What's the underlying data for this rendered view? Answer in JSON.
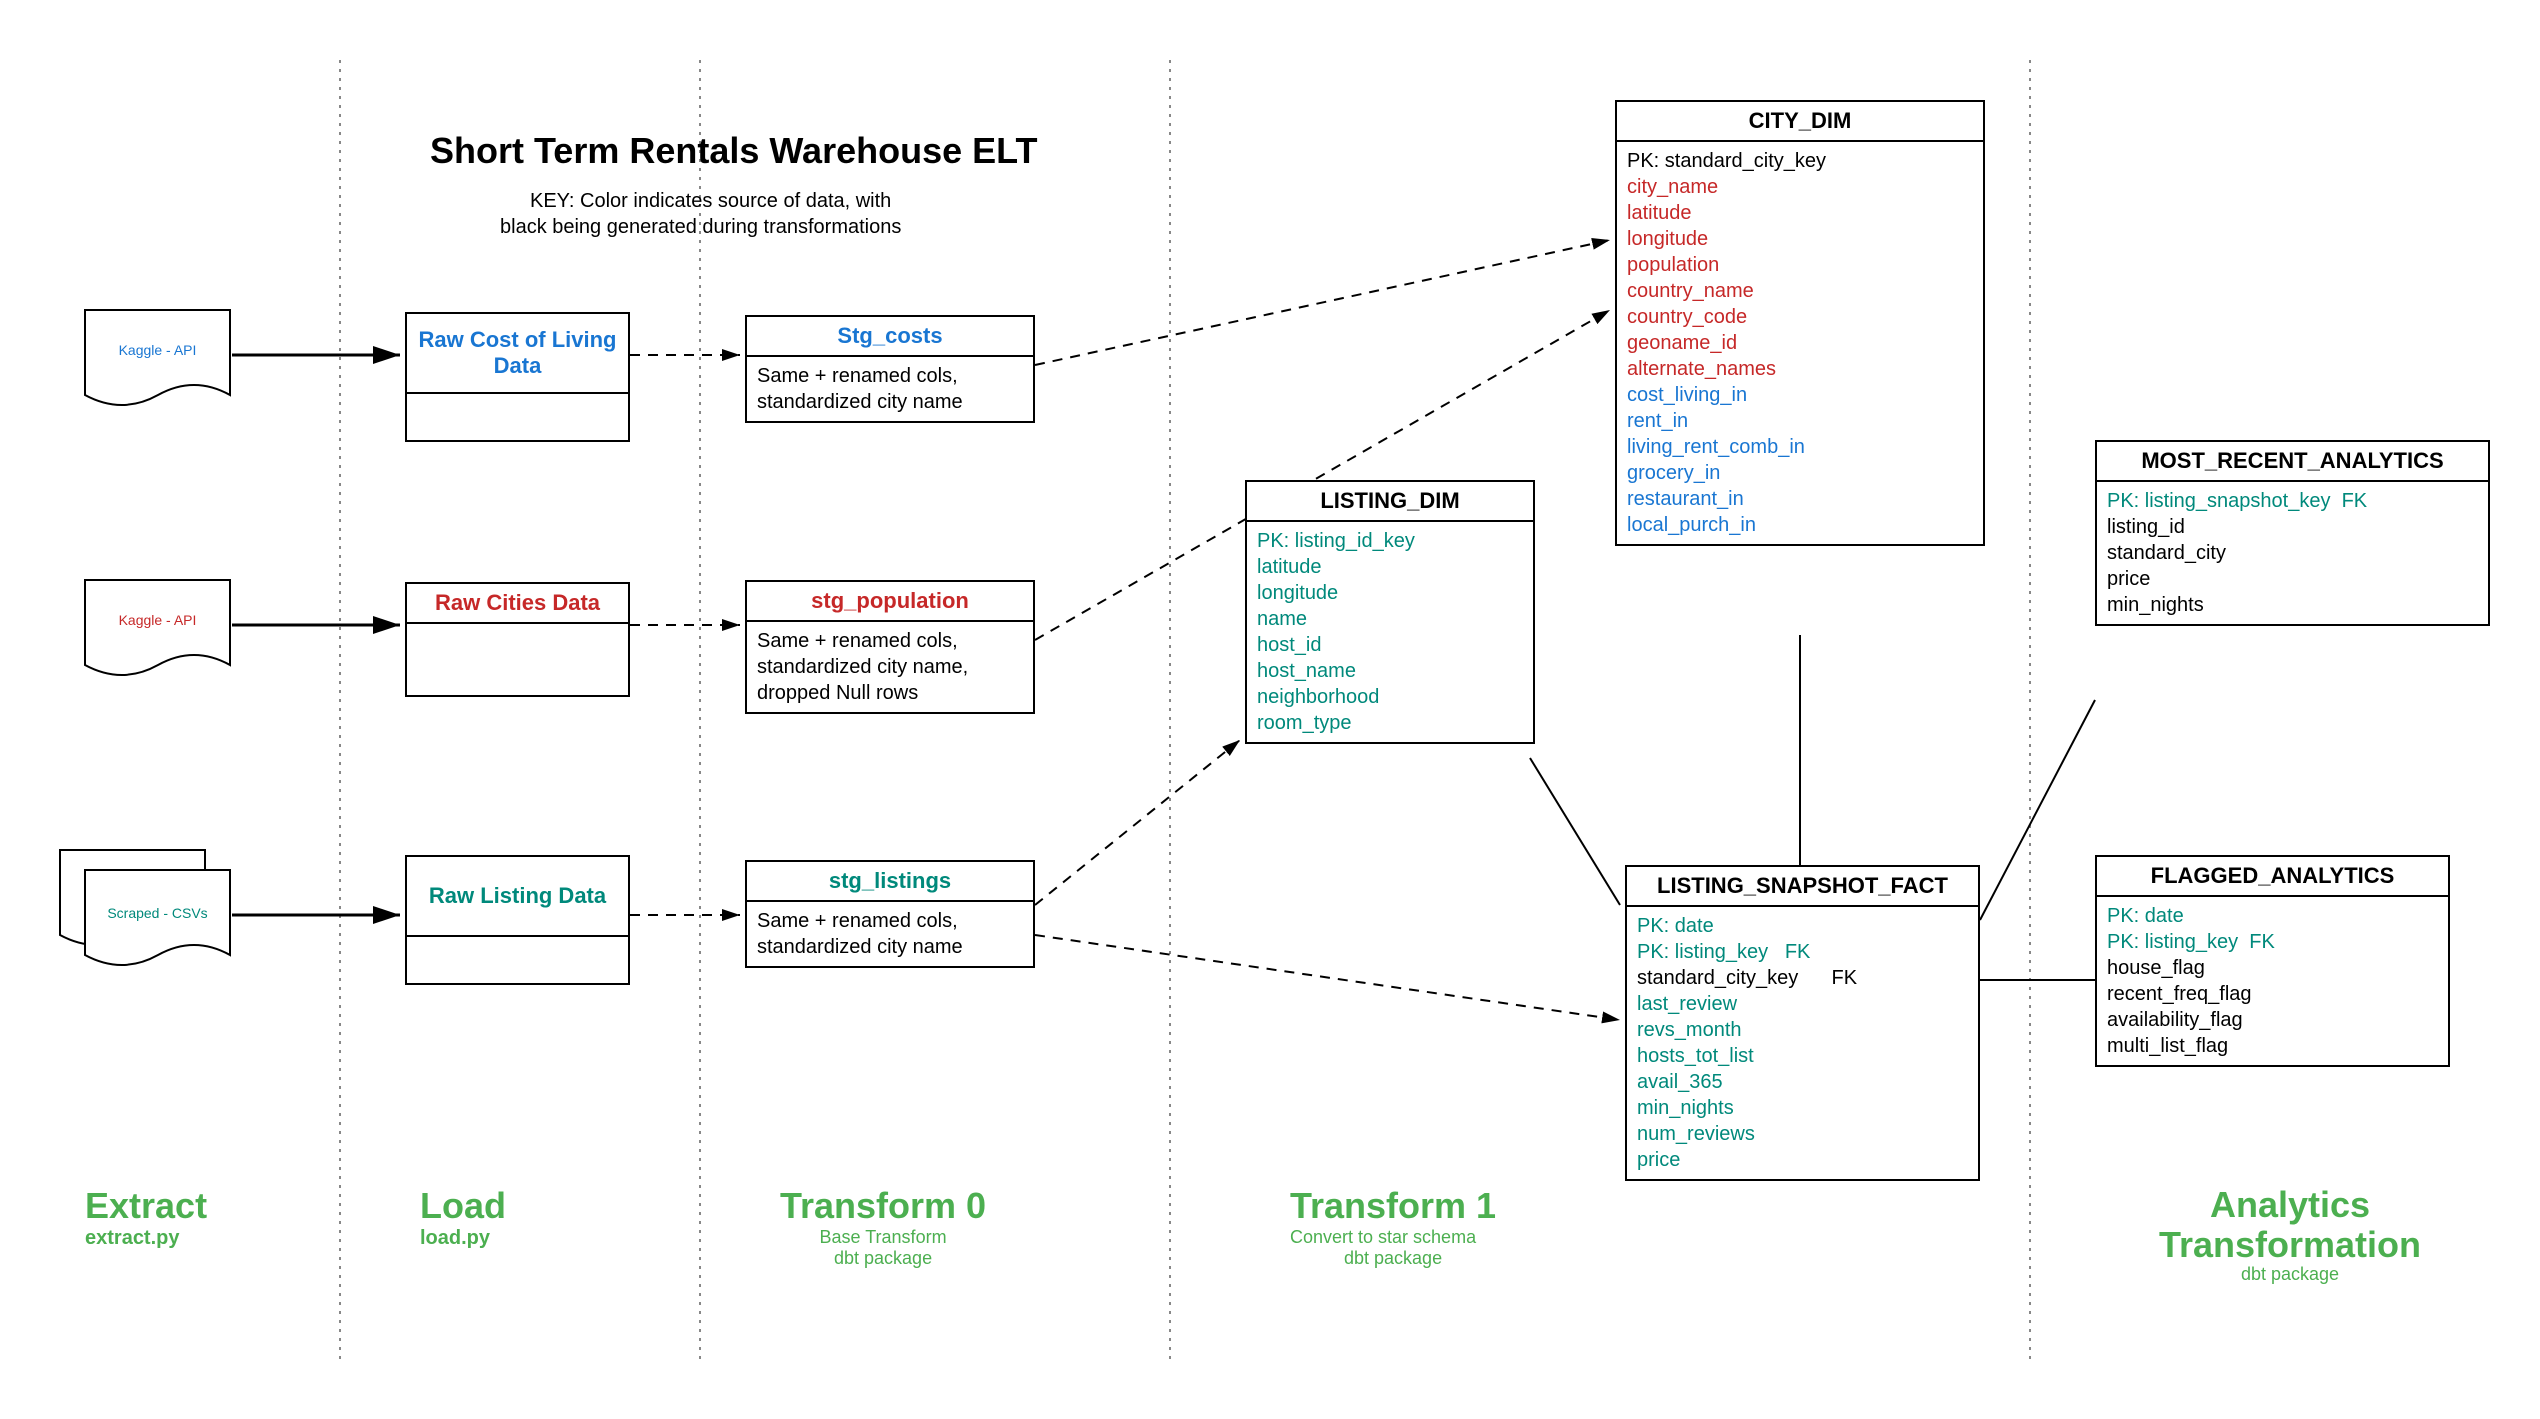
{
  "header": {
    "title": "Short Term Rentals Warehouse ELT",
    "key1": "KEY: Color indicates source of data, with",
    "key2": "black being generated during transformations"
  },
  "lanes": {
    "extract": {
      "title": "Extract",
      "sub": "extract.py"
    },
    "load": {
      "title": "Load",
      "sub": "load.py"
    },
    "t0": {
      "title": "Transform 0",
      "sub1": "Base Transform",
      "sub2": "dbt package"
    },
    "t1": {
      "title": "Transform 1",
      "sub1": "Convert to star schema",
      "sub2": "dbt package"
    },
    "analytics": {
      "title": "Analytics Transformation",
      "sub": "dbt package"
    }
  },
  "sources": {
    "kaggle1": "Kaggle - API",
    "kaggle2": "Kaggle - API",
    "scraped": "Scraped - CSVs"
  },
  "raw": {
    "cost": "Raw Cost of Living Data",
    "cities": "Raw Cities Data",
    "listing": "Raw Listing Data"
  },
  "stg": {
    "costs": {
      "name": "Stg_costs",
      "desc": "Same + renamed cols, standardized city name"
    },
    "population": {
      "name": "stg_population",
      "desc": "Same + renamed cols, standardized city name, dropped Null rows"
    },
    "listings": {
      "name": "stg_listings",
      "desc": "Same + renamed cols, standardized city name"
    }
  },
  "tables": {
    "listing_dim": {
      "name": "LISTING_DIM",
      "fields": [
        "PK: listing_id_key",
        "latitude",
        "longitude",
        "name",
        "host_id",
        "host_name",
        "neighborhood",
        "room_type"
      ]
    },
    "city_dim": {
      "name": "CITY_DIM",
      "pk": "PK: standard_city_key",
      "red": [
        "city_name",
        "latitude",
        "longitude",
        "population",
        "country_name",
        "country_code",
        "geoname_id",
        "alternate_names"
      ],
      "blue": [
        "cost_living_in",
        "rent_in",
        "living_rent_comb_in",
        "grocery_in",
        "restaurant_in",
        "local_purch_in"
      ]
    },
    "fact": {
      "name": "LISTING_SNAPSHOT_FACT",
      "rows": [
        {
          "t": "PK: date",
          "c": "teal"
        },
        {
          "t": "PK: listing_key",
          "c": "teal",
          "suffix": "FK"
        },
        {
          "t": "standard_city_key",
          "c": "black",
          "suffix": "FK"
        },
        {
          "t": "last_review",
          "c": "teal"
        },
        {
          "t": "revs_month",
          "c": "teal"
        },
        {
          "t": "hosts_tot_list",
          "c": "teal"
        },
        {
          "t": "avail_365",
          "c": "teal"
        },
        {
          "t": "min_nights",
          "c": "teal"
        },
        {
          "t": "num_reviews",
          "c": "teal"
        },
        {
          "t": "price",
          "c": "teal"
        }
      ]
    },
    "most_recent": {
      "name": "MOST_RECENT_ANALYTICS",
      "rows": [
        {
          "t": "PK: listing_snapshot_key",
          "c": "teal",
          "suffix": "FK"
        },
        {
          "t": "listing_id",
          "c": "black"
        },
        {
          "t": "standard_city",
          "c": "black"
        },
        {
          "t": "price",
          "c": "black"
        },
        {
          "t": "min_nights",
          "c": "black"
        }
      ]
    },
    "flagged": {
      "name": "FLAGGED_ANALYTICS",
      "rows": [
        {
          "t": "PK: date",
          "c": "teal"
        },
        {
          "t": "PK: listing_key",
          "c": "teal",
          "suffix": "FK"
        },
        {
          "t": "house_flag",
          "c": "black"
        },
        {
          "t": "recent_freq_flag",
          "c": "black"
        },
        {
          "t": "availability_flag",
          "c": "black"
        },
        {
          "t": "multi_list_flag",
          "c": "black"
        }
      ]
    }
  }
}
